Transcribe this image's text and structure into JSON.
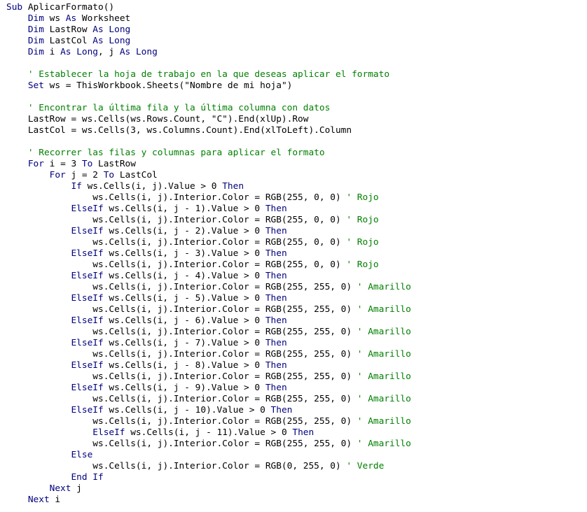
{
  "editor": {
    "colors": {
      "keyword": "#00007f",
      "comment": "#007f00",
      "text": "#000000",
      "background": "#ffffff"
    },
    "lines": [
      {
        "indent": 0,
        "tokens": [
          {
            "t": "kw",
            "v": "Sub "
          },
          {
            "t": "tx",
            "v": "AplicarFormato()"
          }
        ]
      },
      {
        "indent": 4,
        "tokens": [
          {
            "t": "kw",
            "v": "Dim "
          },
          {
            "t": "tx",
            "v": "ws "
          },
          {
            "t": "kw",
            "v": "As "
          },
          {
            "t": "tx",
            "v": "Worksheet"
          }
        ]
      },
      {
        "indent": 4,
        "tokens": [
          {
            "t": "kw",
            "v": "Dim "
          },
          {
            "t": "tx",
            "v": "LastRow "
          },
          {
            "t": "kw",
            "v": "As Long"
          }
        ]
      },
      {
        "indent": 4,
        "tokens": [
          {
            "t": "kw",
            "v": "Dim "
          },
          {
            "t": "tx",
            "v": "LastCol "
          },
          {
            "t": "kw",
            "v": "As Long"
          }
        ]
      },
      {
        "indent": 4,
        "tokens": [
          {
            "t": "kw",
            "v": "Dim "
          },
          {
            "t": "tx",
            "v": "i "
          },
          {
            "t": "kw",
            "v": "As Long"
          },
          {
            "t": "tx",
            "v": ", j "
          },
          {
            "t": "kw",
            "v": "As Long"
          }
        ]
      },
      {
        "indent": 0,
        "tokens": []
      },
      {
        "indent": 4,
        "tokens": [
          {
            "t": "cm",
            "v": "' Establecer la hoja de trabajo en la que deseas aplicar el formato"
          }
        ]
      },
      {
        "indent": 4,
        "tokens": [
          {
            "t": "kw",
            "v": "Set "
          },
          {
            "t": "tx",
            "v": "ws = ThisWorkbook.Sheets(\"Nombre de mi hoja\")"
          }
        ]
      },
      {
        "indent": 0,
        "tokens": []
      },
      {
        "indent": 4,
        "tokens": [
          {
            "t": "cm",
            "v": "' Encontrar la última fila y la última columna con datos"
          }
        ]
      },
      {
        "indent": 4,
        "tokens": [
          {
            "t": "tx",
            "v": "LastRow = ws.Cells(ws.Rows.Count, \"C\").End(xlUp).Row"
          }
        ]
      },
      {
        "indent": 4,
        "tokens": [
          {
            "t": "tx",
            "v": "LastCol = ws.Cells(3, ws.Columns.Count).End(xlToLeft).Column"
          }
        ]
      },
      {
        "indent": 0,
        "tokens": []
      },
      {
        "indent": 4,
        "tokens": [
          {
            "t": "cm",
            "v": "' Recorrer las filas y columnas para aplicar el formato"
          }
        ]
      },
      {
        "indent": 4,
        "tokens": [
          {
            "t": "kw",
            "v": "For "
          },
          {
            "t": "tx",
            "v": "i = 3 "
          },
          {
            "t": "kw",
            "v": "To "
          },
          {
            "t": "tx",
            "v": "LastRow"
          }
        ]
      },
      {
        "indent": 8,
        "tokens": [
          {
            "t": "kw",
            "v": "For "
          },
          {
            "t": "tx",
            "v": "j = 2 "
          },
          {
            "t": "kw",
            "v": "To "
          },
          {
            "t": "tx",
            "v": "LastCol"
          }
        ]
      },
      {
        "indent": 12,
        "tokens": [
          {
            "t": "kw",
            "v": "If "
          },
          {
            "t": "tx",
            "v": "ws.Cells(i, j).Value > 0 "
          },
          {
            "t": "kw",
            "v": "Then"
          }
        ]
      },
      {
        "indent": 16,
        "tokens": [
          {
            "t": "tx",
            "v": "ws.Cells(i, j).Interior.Color = RGB(255, 0, 0) "
          },
          {
            "t": "cm",
            "v": "' Rojo"
          }
        ]
      },
      {
        "indent": 12,
        "tokens": [
          {
            "t": "kw",
            "v": "ElseIf "
          },
          {
            "t": "tx",
            "v": "ws.Cells(i, j - 1).Value > 0 "
          },
          {
            "t": "kw",
            "v": "Then"
          }
        ]
      },
      {
        "indent": 16,
        "tokens": [
          {
            "t": "tx",
            "v": "ws.Cells(i, j).Interior.Color = RGB(255, 0, 0) "
          },
          {
            "t": "cm",
            "v": "' Rojo"
          }
        ]
      },
      {
        "indent": 12,
        "tokens": [
          {
            "t": "kw",
            "v": "ElseIf "
          },
          {
            "t": "tx",
            "v": "ws.Cells(i, j - 2).Value > 0 "
          },
          {
            "t": "kw",
            "v": "Then"
          }
        ]
      },
      {
        "indent": 16,
        "tokens": [
          {
            "t": "tx",
            "v": "ws.Cells(i, j).Interior.Color = RGB(255, 0, 0) "
          },
          {
            "t": "cm",
            "v": "' Rojo"
          }
        ]
      },
      {
        "indent": 12,
        "tokens": [
          {
            "t": "kw",
            "v": "ElseIf "
          },
          {
            "t": "tx",
            "v": "ws.Cells(i, j - 3).Value > 0 "
          },
          {
            "t": "kw",
            "v": "Then"
          }
        ]
      },
      {
        "indent": 16,
        "tokens": [
          {
            "t": "tx",
            "v": "ws.Cells(i, j).Interior.Color = RGB(255, 0, 0) "
          },
          {
            "t": "cm",
            "v": "' Rojo"
          }
        ]
      },
      {
        "indent": 12,
        "tokens": [
          {
            "t": "kw",
            "v": "ElseIf "
          },
          {
            "t": "tx",
            "v": "ws.Cells(i, j - 4).Value > 0 "
          },
          {
            "t": "kw",
            "v": "Then"
          }
        ]
      },
      {
        "indent": 16,
        "tokens": [
          {
            "t": "tx",
            "v": "ws.Cells(i, j).Interior.Color = RGB(255, 255, 0) "
          },
          {
            "t": "cm",
            "v": "' Amarillo"
          }
        ]
      },
      {
        "indent": 12,
        "tokens": [
          {
            "t": "kw",
            "v": "ElseIf "
          },
          {
            "t": "tx",
            "v": "ws.Cells(i, j - 5).Value > 0 "
          },
          {
            "t": "kw",
            "v": "Then"
          }
        ]
      },
      {
        "indent": 16,
        "tokens": [
          {
            "t": "tx",
            "v": "ws.Cells(i, j).Interior.Color = RGB(255, 255, 0) "
          },
          {
            "t": "cm",
            "v": "' Amarillo"
          }
        ]
      },
      {
        "indent": 12,
        "tokens": [
          {
            "t": "kw",
            "v": "ElseIf "
          },
          {
            "t": "tx",
            "v": "ws.Cells(i, j - 6).Value > 0 "
          },
          {
            "t": "kw",
            "v": "Then"
          }
        ]
      },
      {
        "indent": 16,
        "tokens": [
          {
            "t": "tx",
            "v": "ws.Cells(i, j).Interior.Color = RGB(255, 255, 0) "
          },
          {
            "t": "cm",
            "v": "' Amarillo"
          }
        ]
      },
      {
        "indent": 12,
        "tokens": [
          {
            "t": "kw",
            "v": "ElseIf "
          },
          {
            "t": "tx",
            "v": "ws.Cells(i, j - 7).Value > 0 "
          },
          {
            "t": "kw",
            "v": "Then"
          }
        ]
      },
      {
        "indent": 16,
        "tokens": [
          {
            "t": "tx",
            "v": "ws.Cells(i, j).Interior.Color = RGB(255, 255, 0) "
          },
          {
            "t": "cm",
            "v": "' Amarillo"
          }
        ]
      },
      {
        "indent": 12,
        "tokens": [
          {
            "t": "kw",
            "v": "ElseIf "
          },
          {
            "t": "tx",
            "v": "ws.Cells(i, j - 8).Value > 0 "
          },
          {
            "t": "kw",
            "v": "Then"
          }
        ]
      },
      {
        "indent": 16,
        "tokens": [
          {
            "t": "tx",
            "v": "ws.Cells(i, j).Interior.Color = RGB(255, 255, 0) "
          },
          {
            "t": "cm",
            "v": "' Amarillo"
          }
        ]
      },
      {
        "indent": 12,
        "tokens": [
          {
            "t": "kw",
            "v": "ElseIf "
          },
          {
            "t": "tx",
            "v": "ws.Cells(i, j - 9).Value > 0 "
          },
          {
            "t": "kw",
            "v": "Then"
          }
        ]
      },
      {
        "indent": 16,
        "tokens": [
          {
            "t": "tx",
            "v": "ws.Cells(i, j).Interior.Color = RGB(255, 255, 0) "
          },
          {
            "t": "cm",
            "v": "' Amarillo"
          }
        ]
      },
      {
        "indent": 12,
        "tokens": [
          {
            "t": "kw",
            "v": "ElseIf "
          },
          {
            "t": "tx",
            "v": "ws.Cells(i, j - 10).Value > 0 "
          },
          {
            "t": "kw",
            "v": "Then"
          }
        ]
      },
      {
        "indent": 16,
        "tokens": [
          {
            "t": "tx",
            "v": "ws.Cells(i, j).Interior.Color = RGB(255, 255, 0) "
          },
          {
            "t": "cm",
            "v": "' Amarillo"
          }
        ]
      },
      {
        "indent": 16,
        "tokens": [
          {
            "t": "kw",
            "v": "ElseIf "
          },
          {
            "t": "tx",
            "v": "ws.Cells(i, j - 11).Value > 0 "
          },
          {
            "t": "kw",
            "v": "Then"
          }
        ]
      },
      {
        "indent": 16,
        "tokens": [
          {
            "t": "tx",
            "v": "ws.Cells(i, j).Interior.Color = RGB(255, 255, 0) "
          },
          {
            "t": "cm",
            "v": "' Amarillo"
          }
        ]
      },
      {
        "indent": 12,
        "tokens": [
          {
            "t": "kw",
            "v": "Else"
          }
        ]
      },
      {
        "indent": 16,
        "tokens": [
          {
            "t": "tx",
            "v": "ws.Cells(i, j).Interior.Color = RGB(0, 255, 0) "
          },
          {
            "t": "cm",
            "v": "' Verde"
          }
        ]
      },
      {
        "indent": 12,
        "tokens": [
          {
            "t": "kw",
            "v": "End If"
          }
        ]
      },
      {
        "indent": 8,
        "tokens": [
          {
            "t": "kw",
            "v": "Next "
          },
          {
            "t": "tx",
            "v": "j"
          }
        ]
      },
      {
        "indent": 4,
        "tokens": [
          {
            "t": "kw",
            "v": "Next "
          },
          {
            "t": "tx",
            "v": "i"
          }
        ]
      }
    ]
  }
}
